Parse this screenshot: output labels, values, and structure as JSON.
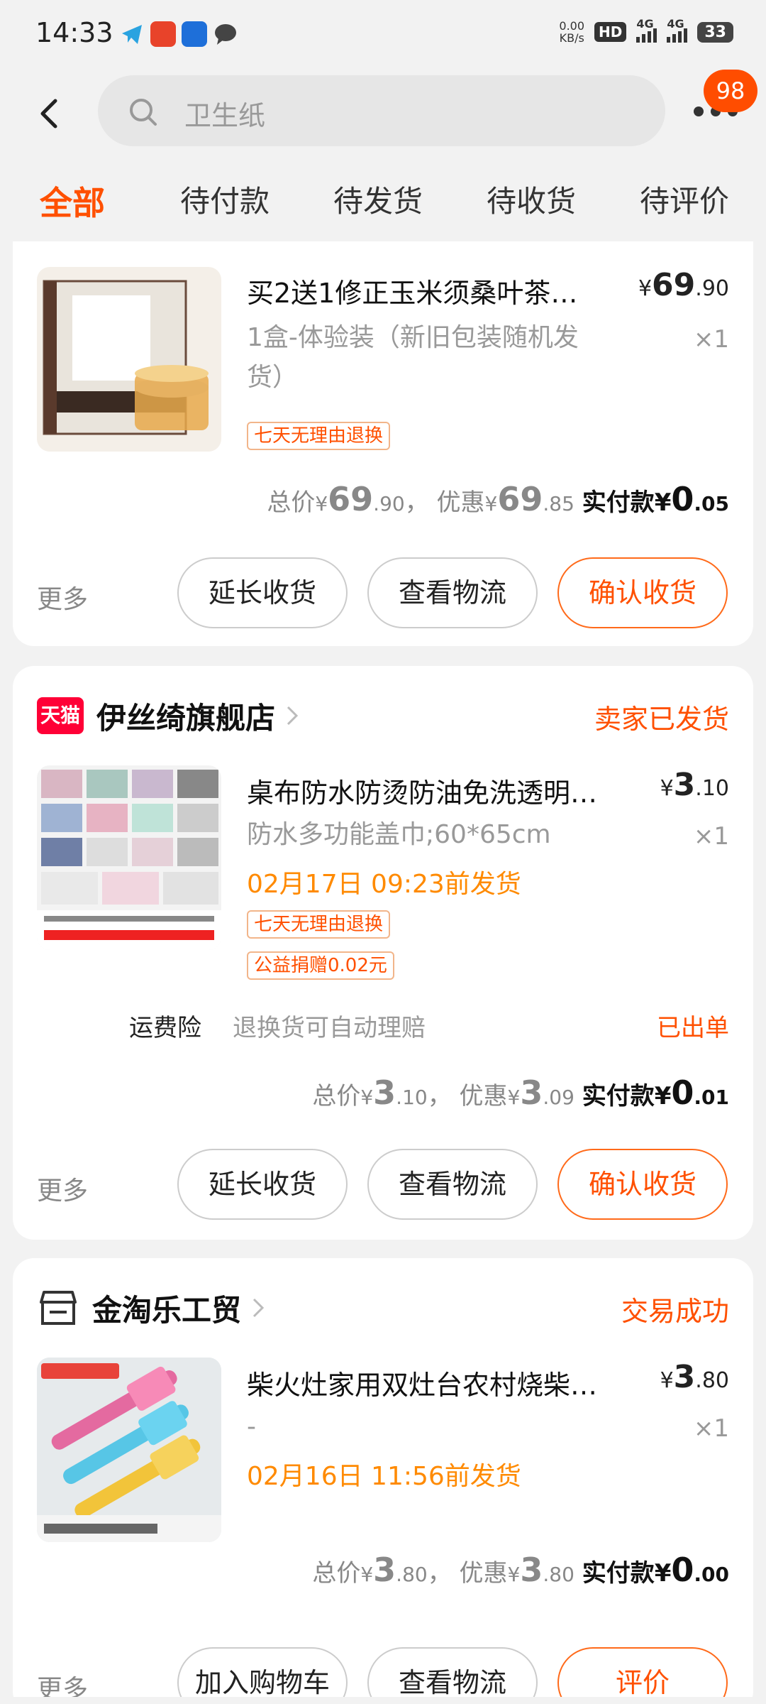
{
  "status_bar": {
    "time": "14:33",
    "net_speed_value": "0.00",
    "net_speed_unit": "KB/s",
    "hd": "HD",
    "signal1": "4G",
    "signal2": "4G",
    "battery": "33"
  },
  "header": {
    "search_placeholder": "卫生纸",
    "badge": "98"
  },
  "tabs": [
    "全部",
    "待付款",
    "待发货",
    "待收货",
    "待评价"
  ],
  "orders": [
    {
      "item": {
        "title": "买2送1修正玉米须桑叶茶…",
        "price_int": "69",
        "price_dec": ".90",
        "spec": "1盒-体验装（新旧包装随机发货）",
        "qty": "×1",
        "tags": [
          "七天无理由退换"
        ]
      },
      "totals": {
        "total_label": "总价",
        "total_int": "69",
        "total_dec": ".90",
        "discount_label": "优惠",
        "discount_int": "69",
        "discount_dec": ".85",
        "paid_label": "实付款",
        "paid_int": "0",
        "paid_dec": ".05"
      },
      "actions": {
        "more": "更多",
        "btn1": "延长收货",
        "btn2": "查看物流",
        "btn3": "确认收货"
      }
    },
    {
      "store": "伊丝绮旗舰店",
      "store_logo": "天猫",
      "status": "卖家已发货",
      "item": {
        "title": "桌布防水防烫防油免洗透明…",
        "price_int": "3",
        "price_dec": ".10",
        "spec": "防水多功能盖巾;60*65cm",
        "qty": "×1",
        "ship_time": "02月17日 09:23前发货",
        "tags": [
          "七天无理由退换",
          "公益捐赠0.02元"
        ]
      },
      "insurance": {
        "label": "运费险",
        "desc": "退换货可自动理赔",
        "status": "已出单"
      },
      "totals": {
        "total_label": "总价",
        "total_int": "3",
        "total_dec": ".10",
        "discount_label": "优惠",
        "discount_int": "3",
        "discount_dec": ".09",
        "paid_label": "实付款",
        "paid_int": "0",
        "paid_dec": ".01"
      },
      "actions": {
        "more": "更多",
        "btn1": "延长收货",
        "btn2": "查看物流",
        "btn3": "确认收货"
      }
    },
    {
      "store": "金淘乐工贸",
      "status": "交易成功",
      "item": {
        "title": "柴火灶家用双灶台农村烧柴…",
        "price_int": "3",
        "price_dec": ".80",
        "spec": "-",
        "qty": "×1",
        "ship_time": "02月16日 11:56前发货"
      },
      "totals": {
        "total_label": "总价",
        "total_int": "3",
        "total_dec": ".80",
        "discount_label": "优惠",
        "discount_int": "3",
        "discount_dec": ".80",
        "paid_label": "实付款",
        "paid_int": "0",
        "paid_dec": ".00"
      },
      "actions": {
        "more": "更多",
        "btn1": "加入购物车",
        "btn2": "查看物流",
        "btn3": "评价"
      }
    }
  ],
  "colors": {
    "accent": "#ff5000",
    "ship_time": "#ff8a00",
    "tmall": "#ff0036"
  }
}
